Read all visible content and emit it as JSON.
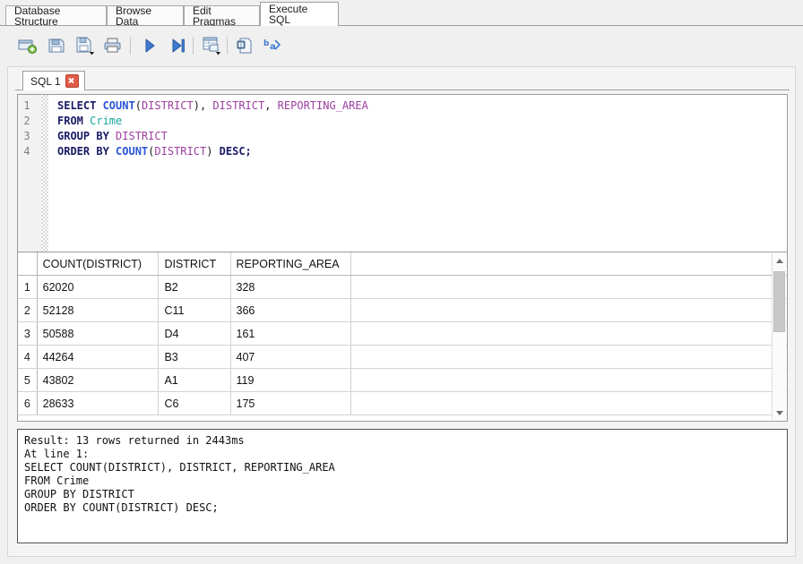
{
  "window": {
    "tabs": [
      {
        "label": "Database Structure",
        "active": false
      },
      {
        "label": "Browse Data",
        "active": false
      },
      {
        "label": "Edit Pragmas",
        "active": false
      },
      {
        "label": "Execute SQL",
        "active": true
      }
    ]
  },
  "toolbar": {
    "buttons": [
      {
        "name": "open-new-tab-icon",
        "title": "Open tab"
      },
      {
        "name": "open-sql-file-icon",
        "title": "Open SQL file"
      },
      {
        "name": "save-sql-file-icon",
        "title": "Save SQL file"
      },
      {
        "name": "print-icon",
        "title": "Print"
      },
      {
        "name": "execute-all-icon",
        "title": "Execute all"
      },
      {
        "name": "execute-current-line-icon",
        "title": "Execute current line"
      },
      {
        "name": "save-results-icon",
        "title": "Save results"
      },
      {
        "name": "find-icon",
        "title": "Find"
      },
      {
        "name": "format-sql-icon",
        "title": "Format SQL"
      }
    ]
  },
  "sql_tab": {
    "label": "SQL 1",
    "close_label": "×"
  },
  "editor": {
    "lines": [
      {
        "num": "1",
        "tokens": [
          {
            "t": "SELECT ",
            "c": "kw"
          },
          {
            "t": "COUNT",
            "c": "fn"
          },
          {
            "t": "(",
            "c": "pn"
          },
          {
            "t": "DISTRICT",
            "c": "id"
          },
          {
            "t": "), ",
            "c": "pn"
          },
          {
            "t": "DISTRICT",
            "c": "id"
          },
          {
            "t": ", ",
            "c": "pn"
          },
          {
            "t": "REPORTING_AREA",
            "c": "id"
          }
        ]
      },
      {
        "num": "2",
        "tokens": [
          {
            "t": "FROM ",
            "c": "kw"
          },
          {
            "t": "Crime",
            "c": "tbl"
          }
        ]
      },
      {
        "num": "3",
        "tokens": [
          {
            "t": "GROUP BY ",
            "c": "kw"
          },
          {
            "t": "DISTRICT",
            "c": "id"
          }
        ]
      },
      {
        "num": "4",
        "tokens": [
          {
            "t": "ORDER BY ",
            "c": "kw"
          },
          {
            "t": "COUNT",
            "c": "fn"
          },
          {
            "t": "(",
            "c": "pn"
          },
          {
            "t": "DISTRICT",
            "c": "id"
          },
          {
            "t": ") ",
            "c": "pn"
          },
          {
            "t": "DESC;",
            "c": "kw"
          }
        ]
      }
    ]
  },
  "results": {
    "columns": [
      "COUNT(DISTRICT)",
      "DISTRICT",
      "REPORTING_AREA"
    ],
    "rows": [
      {
        "n": "1",
        "cells": [
          "62020",
          "B2",
          "328"
        ]
      },
      {
        "n": "2",
        "cells": [
          "52128",
          "C11",
          "366"
        ]
      },
      {
        "n": "3",
        "cells": [
          "50588",
          "D4",
          "161"
        ]
      },
      {
        "n": "4",
        "cells": [
          "44264",
          "B3",
          "407"
        ]
      },
      {
        "n": "5",
        "cells": [
          "43802",
          "A1",
          "119"
        ]
      },
      {
        "n": "6",
        "cells": [
          "28633",
          "C6",
          "175"
        ]
      }
    ]
  },
  "log": {
    "text": "Result: 13 rows returned in 2443ms\nAt line 1:\nSELECT COUNT(DISTRICT), DISTRICT, REPORTING_AREA\nFROM Crime\nGROUP BY DISTRICT\nORDER BY COUNT(DISTRICT) DESC;"
  },
  "colors": {
    "accent_blue": "#2a56d6",
    "identifier_purple": "#9c3fa0",
    "table_teal": "#19a6a0",
    "keyword_navy": "#1a1a66",
    "close_red": "#e05c49"
  }
}
